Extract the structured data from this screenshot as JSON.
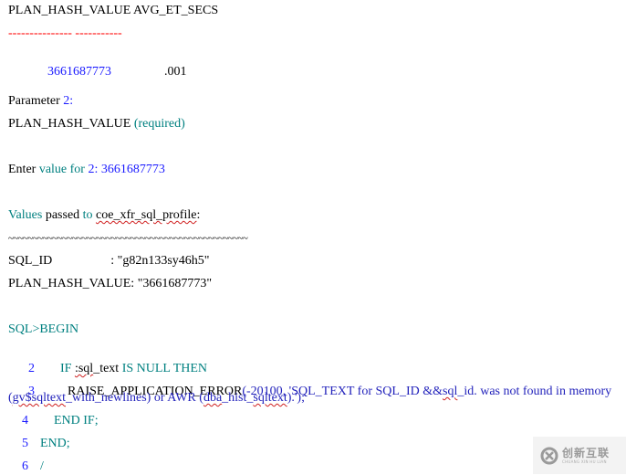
{
  "colors": {
    "keyword": "#008080",
    "number": "#1a1aff",
    "string": "#2222bb",
    "separator": "#ff0000",
    "text": "#000000"
  },
  "result_table": {
    "header": "PLAN_HASH_VALUE AVG_ET_SECS",
    "separator": "--------------- -----------",
    "row": {
      "plan_hash_value": "3661687773",
      "avg_et_secs": ".001"
    }
  },
  "parameter": {
    "label": "Parameter",
    "number": "2:",
    "name": "PLAN_HASH_VALUE",
    "required": "(required)"
  },
  "enter_prompt": {
    "enter": "Enter",
    "value_for": "value for",
    "number": "2: 3661687773"
  },
  "values_passed": {
    "values": "Values",
    "passed": "passed",
    "to": "to",
    "procedure": "coe_xfr_sql_profile",
    "colon": ":",
    "tilde_line": "~~~~~~~~~~~~~~~~~~~~~~~~~~~~~~~~~~~~~~~~~~~~~~~~~",
    "sql_id_label": "SQL_ID",
    "sql_id_value": ": \"g82n133sy46h5\"",
    "phv_label": "PLAN_HASH_VALUE:",
    "phv_value": "\"3661687773\""
  },
  "sql_block": {
    "line1": "SQL>BEGIN",
    "line2": {
      "num": "2",
      "if": "IF",
      "var": ":sql",
      "var_rest": "_text",
      "cond": "IS NULL THEN"
    },
    "line3": {
      "num": "3",
      "func": "RAISE_APPLICATION_ERROR",
      "args": "(-20100, 'SQL_TEXT for SQL_ID &&",
      "sql": "sql",
      "args2": "_id. was not found in memory",
      "cont_open": "(",
      "gv": "gv$sqltext",
      "cont_mid": "_with_newlines) or AWR (",
      "dba": "dba",
      "cont_mid2": "_hist_",
      "sqltext": "sqltext",
      "cont_end": ").');"
    },
    "line4": {
      "num": "4",
      "text": "END IF;"
    },
    "line5": {
      "num": "5",
      "text": "END;"
    },
    "line6": {
      "num": "6",
      "text": "/"
    }
  },
  "watermark": {
    "logo_icon": "cx-logo-icon",
    "cn_text": "创新互联",
    "en_text": "CHUANG XIN HU LIAN"
  }
}
